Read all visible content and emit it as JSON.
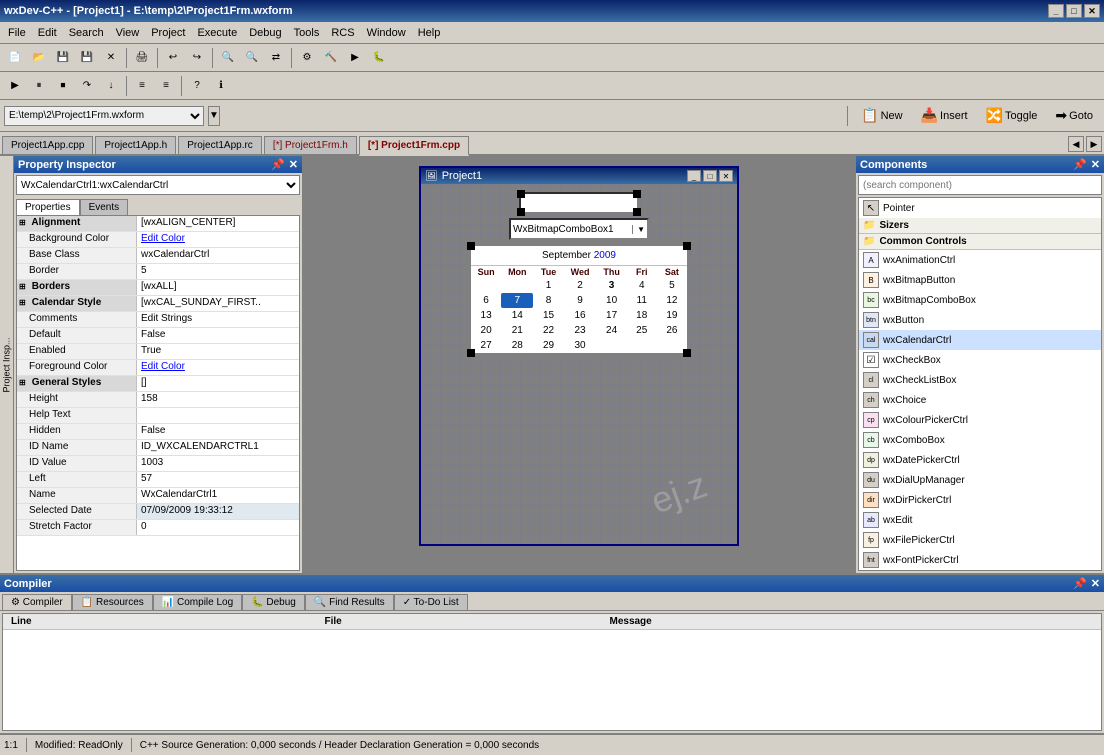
{
  "titlebar": {
    "text": "wxDev-C++ - [Project1] - E:\\temp\\2\\Project1Frm.wxform",
    "controls": [
      "_",
      "□",
      "✕"
    ]
  },
  "menubar": {
    "items": [
      "File",
      "Edit",
      "Search",
      "View",
      "Project",
      "Execute",
      "Debug",
      "Tools",
      "RCS",
      "Window",
      "Help"
    ]
  },
  "toolbar3": {
    "new_label": "New",
    "insert_label": "Insert",
    "toggle_label": "Toggle",
    "goto_label": "Goto"
  },
  "tabs": [
    {
      "label": "Project1App.cpp",
      "active": false,
      "modified": false
    },
    {
      "label": "Project1App.h",
      "active": false,
      "modified": false
    },
    {
      "label": "Project1App.rc",
      "active": false,
      "modified": false
    },
    {
      "label": "[*] Project1Frm.h",
      "active": false,
      "modified": true
    },
    {
      "label": "[*] Project1Frm.cpp",
      "active": true,
      "modified": true
    }
  ],
  "property_inspector": {
    "title": "Property Inspector",
    "selector_value": "WxCalendarCtrl1:wxCalendarCtrl",
    "tabs": [
      "Properties",
      "Events"
    ],
    "active_tab": "Properties",
    "rows": [
      {
        "name": "Alignment",
        "value": "[wxALIGN_CENTER]",
        "group": true,
        "expand": true
      },
      {
        "name": "Background Color",
        "value": "Edit Color",
        "edit_color": true
      },
      {
        "name": "Base Class",
        "value": "wxCalendarCtrl"
      },
      {
        "name": "Border",
        "value": "5"
      },
      {
        "name": "Borders",
        "value": "[wxALL]",
        "group": true,
        "expand": true
      },
      {
        "name": "Calendar Style",
        "value": "[wxCAL_SUNDAY_FIRST..",
        "group": true,
        "expand": true
      },
      {
        "name": "Comments",
        "value": "Edit Strings"
      },
      {
        "name": "Default",
        "value": "False"
      },
      {
        "name": "Enabled",
        "value": "True"
      },
      {
        "name": "Foreground Color",
        "value": "Edit Color",
        "edit_color": true
      },
      {
        "name": "General Styles",
        "value": "[]",
        "group": true,
        "expand": true
      },
      {
        "name": "Height",
        "value": "158"
      },
      {
        "name": "Help Text",
        "value": ""
      },
      {
        "name": "Hidden",
        "value": "False"
      },
      {
        "name": "ID Name",
        "value": "ID_WXCALENDARCTRL1"
      },
      {
        "name": "ID Value",
        "value": "1003"
      },
      {
        "name": "Left",
        "value": "57"
      },
      {
        "name": "Name",
        "value": "WxCalendarCtrl1"
      },
      {
        "name": "Selected Date",
        "value": "07/09/2009 19:33:12"
      },
      {
        "name": "Stretch Factor",
        "value": "0"
      }
    ]
  },
  "form": {
    "title": "Project1",
    "textbox_value": "",
    "combobox_value": "WxBitmapComboBox1"
  },
  "calendar": {
    "month": "September",
    "year": "2009",
    "headers": [
      "Sun",
      "Mon",
      "Tue",
      "Wed",
      "Thu",
      "Fri",
      "Sat"
    ],
    "weeks": [
      [
        "",
        "",
        "1",
        "2",
        "3",
        "4",
        "5"
      ],
      [
        "6",
        "7",
        "8",
        "9",
        "10",
        "11",
        "12"
      ],
      [
        "13",
        "14",
        "15",
        "16",
        "17",
        "18",
        "19"
      ],
      [
        "20",
        "21",
        "22",
        "23",
        "24",
        "25",
        "26"
      ],
      [
        "27",
        "28",
        "29",
        "30",
        "",
        "",
        ""
      ]
    ],
    "selected_day": "7",
    "today_highlight": "3"
  },
  "components": {
    "title": "Components",
    "search_placeholder": "(search component)",
    "items": [
      {
        "type": "item",
        "label": "Pointer",
        "icon": "↖"
      },
      {
        "type": "section",
        "label": "Sizers"
      },
      {
        "type": "section",
        "label": "Common Controls"
      },
      {
        "type": "item",
        "label": "wxAnimationCtrl",
        "icon": "A"
      },
      {
        "type": "item",
        "label": "wxBitmapButton",
        "icon": "B"
      },
      {
        "type": "item",
        "label": "wxBitmapComboBox",
        "icon": "bc"
      },
      {
        "type": "item",
        "label": "wxButton",
        "icon": "btn"
      },
      {
        "type": "item",
        "label": "wxCalendarCtrl",
        "icon": "cal",
        "selected": true
      },
      {
        "type": "item",
        "label": "wxCheckBox",
        "icon": "☑"
      },
      {
        "type": "item",
        "label": "wxCheckListBox",
        "icon": "cl"
      },
      {
        "type": "item",
        "label": "wxChoice",
        "icon": "ch"
      },
      {
        "type": "item",
        "label": "wxColourPickerCtrl",
        "icon": "cp"
      },
      {
        "type": "item",
        "label": "wxComboBox",
        "icon": "cb"
      },
      {
        "type": "item",
        "label": "wxDatePickerCtrl",
        "icon": "dp"
      },
      {
        "type": "item",
        "label": "wxDialUpManager",
        "icon": "du"
      },
      {
        "type": "item",
        "label": "wxDirPickerCtrl",
        "icon": "dir"
      },
      {
        "type": "item",
        "label": "wxEdit",
        "icon": "ab"
      },
      {
        "type": "item",
        "label": "wxFilePickerCtrl",
        "icon": "fp"
      },
      {
        "type": "item",
        "label": "wxFontPickerCtrl",
        "icon": "fnt"
      }
    ]
  },
  "compiler": {
    "title": "Compiler",
    "tabs": [
      "Compiler",
      "Resources",
      "Compile Log",
      "Debug",
      "Find Results",
      "To-Do List"
    ],
    "columns": [
      "Line",
      "File",
      "Message"
    ]
  },
  "statusbar": {
    "position": "1:1",
    "mode": "Modified: ReadOnly",
    "message": "C++ Source Generation: 0,000 seconds / Header Declaration Generation = 0,000 seconds"
  }
}
